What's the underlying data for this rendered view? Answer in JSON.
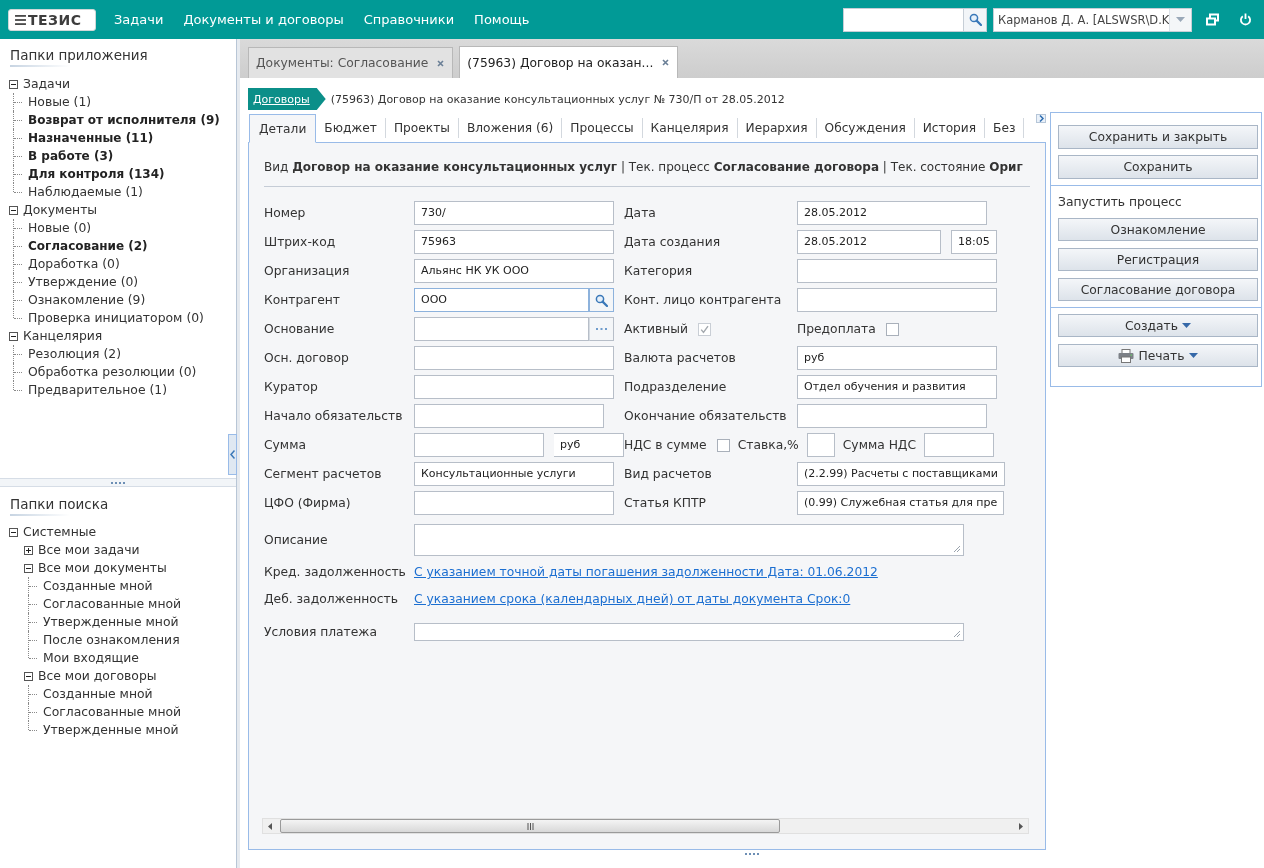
{
  "top_bar": {
    "logo": "ТЕЗИС",
    "menu": [
      "Задачи",
      "Документы и договоры",
      "Справочники",
      "Помощь"
    ],
    "user": "Карманов Д. А. [ALSWSR\\D.K"
  },
  "sidebar": {
    "app_folders": {
      "title": "Папки приложения",
      "tree": [
        {
          "label": "Задачи",
          "expanded": true,
          "bold": false,
          "children": [
            {
              "label": "Новые (1)",
              "bold": false
            },
            {
              "label": "Возврат от исполнителя (9)",
              "bold": true
            },
            {
              "label": "Назначенные (11)",
              "bold": true
            },
            {
              "label": "В работе (3)",
              "bold": true
            },
            {
              "label": "Для контроля (134)",
              "bold": true
            },
            {
              "label": "Наблюдаемые (1)",
              "bold": false
            }
          ]
        },
        {
          "label": "Документы",
          "expanded": true,
          "bold": false,
          "children": [
            {
              "label": "Новые (0)",
              "bold": false
            },
            {
              "label": "Согласование (2)",
              "bold": true
            },
            {
              "label": "Доработка (0)",
              "bold": false
            },
            {
              "label": "Утверждение (0)",
              "bold": false
            },
            {
              "label": "Ознакомление (9)",
              "bold": false
            },
            {
              "label": "Проверка инициатором (0)",
              "bold": false
            }
          ]
        },
        {
          "label": "Канцелярия",
          "expanded": true,
          "bold": false,
          "children": [
            {
              "label": "Резолюция (2)",
              "bold": false
            },
            {
              "label": "Обработка резолюции (0)",
              "bold": false
            },
            {
              "label": "Предварительное (1)",
              "bold": false
            }
          ]
        }
      ]
    },
    "search_folders": {
      "title": "Папки поиска",
      "tree": [
        {
          "label": "Системные",
          "expanded": true,
          "children": [
            {
              "label": "Все мои задачи",
              "expanded": false
            },
            {
              "label": "Все мои документы",
              "expanded": true,
              "children": [
                {
                  "label": "Созданные мной"
                },
                {
                  "label": "Согласованные мной"
                },
                {
                  "label": "Утвержденные мной"
                },
                {
                  "label": "После ознакомления"
                },
                {
                  "label": "Мои входящие"
                }
              ]
            },
            {
              "label": "Все мои договоры",
              "expanded": true,
              "children": [
                {
                  "label": "Созданные мной"
                },
                {
                  "label": "Согласованные мной"
                },
                {
                  "label": "Утвержденные мной"
                }
              ]
            }
          ]
        }
      ]
    }
  },
  "tabs": [
    {
      "label": "Документы: Согласование",
      "selected": false
    },
    {
      "label": "(75963) Договор на оказан...",
      "selected": true
    }
  ],
  "breadcrumb": {
    "link": "Договоры",
    "title": "(75963) Договор на оказание консультационных услуг № 730/П от 28.05.2012"
  },
  "detail_tabs": [
    {
      "label": "Детали",
      "selected": true
    },
    {
      "label": "Бюджет",
      "selected": false
    },
    {
      "label": "Проекты",
      "selected": false
    },
    {
      "label": "Вложения (6)",
      "selected": false
    },
    {
      "label": "Процессы",
      "selected": false
    },
    {
      "label": "Канцелярия",
      "selected": false
    },
    {
      "label": "Иерархия",
      "selected": false
    },
    {
      "label": "Обсуждения",
      "selected": false
    },
    {
      "label": "История",
      "selected": false
    },
    {
      "label": "Без",
      "selected": false
    }
  ],
  "form": {
    "header": "Вид **Договор на оказание консультационных услуг** | Тек. процесс **Согласование договора** | Тек. состояние **Ориг**",
    "rows": [
      {
        "cells": [
          {
            "kind": "pair",
            "items": [
              {
                "kind": "label",
                "text": "Номер"
              },
              {
                "kind": "text",
                "value": "730/"
              }
            ]
          },
          {
            "kind": "pair",
            "items": [
              {
                "kind": "label",
                "text": "Дата"
              },
              {
                "kind": "date",
                "value": "28.05.2012"
              }
            ]
          }
        ]
      },
      {
        "cells": [
          {
            "kind": "pair",
            "items": [
              {
                "kind": "label",
                "text": "Штрих-код"
              },
              {
                "kind": "text",
                "value": "75963"
              }
            ]
          },
          {
            "kind": "pair",
            "items": [
              {
                "kind": "label",
                "text": "Дата создания"
              },
              {
                "kind": "datepart",
                "value": "28.05.2012"
              },
              {
                "kind": "time",
                "value": "18:05"
              }
            ]
          }
        ]
      },
      {
        "cells": [
          {
            "kind": "pair",
            "items": [
              {
                "kind": "label",
                "text": "Организация"
              },
              {
                "kind": "text",
                "value": "Альянс НК УК ООО"
              }
            ]
          },
          {
            "kind": "pair",
            "items": [
              {
                "kind": "label",
                "text": "Категория"
              },
              {
                "kind": "text"
              }
            ]
          }
        ]
      },
      {
        "cells": [
          {
            "kind": "pair",
            "items": [
              {
                "kind": "label",
                "text": "Контрагент"
              },
              {
                "kind": "lookup",
                "value": "ООО"
              }
            ]
          },
          {
            "kind": "pair",
            "items": [
              {
                "kind": "label",
                "text": "Конт. лицо контрагента"
              },
              {
                "kind": "text"
              }
            ]
          }
        ]
      },
      {
        "cells": [
          {
            "kind": "pair",
            "items": [
              {
                "kind": "label",
                "text": "Основание"
              },
              {
                "kind": "picker"
              }
            ]
          },
          {
            "kind": "pair",
            "items": [
              {
                "kind": "check",
                "label": "Активный",
                "checked": true,
                "disabled": true
              },
              {
                "kind": "check",
                "label": "Предоплата",
                "checked": false,
                "disabled": false
              }
            ]
          }
        ]
      },
      {
        "cells": [
          {
            "kind": "pair",
            "items": [
              {
                "kind": "label",
                "text": "Осн. договор"
              },
              {
                "kind": "text"
              }
            ]
          },
          {
            "kind": "pair",
            "items": [
              {
                "kind": "label",
                "text": "Валюта расчетов"
              },
              {
                "kind": "text",
                "value": "руб"
              }
            ]
          }
        ]
      },
      {
        "cells": [
          {
            "kind": "pair",
            "items": [
              {
                "kind": "label",
                "text": "Куратор"
              },
              {
                "kind": "text"
              }
            ]
          },
          {
            "kind": "pair",
            "items": [
              {
                "kind": "label",
                "text": "Подразделение"
              },
              {
                "kind": "text",
                "value": "Отдел обучения и развития"
              }
            ]
          }
        ]
      },
      {
        "cells": [
          {
            "kind": "pair",
            "items": [
              {
                "kind": "label",
                "text": "Начало обязательств"
              },
              {
                "kind": "date"
              }
            ]
          },
          {
            "kind": "pair",
            "items": [
              {
                "kind": "label",
                "text": "Окончание обязательств"
              },
              {
                "kind": "date"
              }
            ]
          }
        ]
      },
      {
        "cells": [
          {
            "kind": "pair",
            "items": [
              {
                "kind": "label",
                "text": "Сумма"
              },
              {
                "kind": "amount"
              },
              {
                "kind": "currency",
                "value": "руб"
              }
            ]
          },
          {
            "kind": "inline",
            "items": [
              {
                "kind": "check",
                "label": "НДС в сумме",
                "checked": false,
                "disabled": false
              },
              {
                "kind": "label",
                "text": "Ставка,%"
              },
              {
                "kind": "percent"
              },
              {
                "kind": "label",
                "text": "Сумма НДС"
              },
              {
                "kind": "sum"
              }
            ]
          }
        ]
      },
      {
        "cells": [
          {
            "kind": "pair",
            "items": [
              {
                "kind": "label",
                "text": "Сегмент расчетов"
              },
              {
                "kind": "text",
                "value": "Консультационные услуги"
              }
            ]
          },
          {
            "kind": "pair",
            "items": [
              {
                "kind": "label",
                "text": "Вид расчетов"
              },
              {
                "kind": "text",
                "value": "(2.2.99) Расчеты с поставщиками"
              }
            ]
          }
        ]
      },
      {
        "cells": [
          {
            "kind": "pair",
            "items": [
              {
                "kind": "label",
                "text": "ЦФО (Фирма)"
              },
              {
                "kind": "text"
              }
            ]
          },
          {
            "kind": "pair",
            "items": [
              {
                "kind": "label",
                "text": "Статья КПТР"
              },
              {
                "kind": "text",
                "value": "(0.99) Служебная статья для пре"
              }
            ]
          }
        ]
      },
      {
        "cells": [
          {
            "kind": "pair",
            "items": [
              {
                "kind": "label",
                "text": "Описание"
              },
              {
                "kind": "textarea"
              }
            ]
          }
        ]
      },
      {
        "cells": [
          {
            "kind": "pair",
            "items": [
              {
                "kind": "label",
                "text": "Кред. задолженность"
              },
              {
                "kind": "link",
                "text": "С указанием точной даты погашения задолженности Дата: 01.06.2012"
              }
            ]
          }
        ]
      },
      {
        "cells": [
          {
            "kind": "pair",
            "items": [
              {
                "kind": "label",
                "text": "Деб. задолженность"
              },
              {
                "kind": "link",
                "text": "С указанием срока (календарных дней) от даты документа Срок:0"
              }
            ]
          }
        ]
      },
      {
        "cells": [
          {
            "kind": "pair",
            "items": [
              {
                "kind": "label",
                "text": "Условия платежа"
              },
              {
                "kind": "memo"
              }
            ]
          }
        ]
      }
    ]
  },
  "actions": {
    "main": [
      {
        "label": "Сохранить и закрыть"
      },
      {
        "label": "Сохранить"
      }
    ],
    "process_title": "Запустить процесс",
    "process": [
      {
        "label": "Ознакомление"
      },
      {
        "label": "Регистрация"
      },
      {
        "label": "Согласование договора"
      }
    ],
    "more": [
      {
        "label": "Создать",
        "kind": "menu"
      },
      {
        "label": "Печать",
        "kind": "print"
      }
    ]
  }
}
